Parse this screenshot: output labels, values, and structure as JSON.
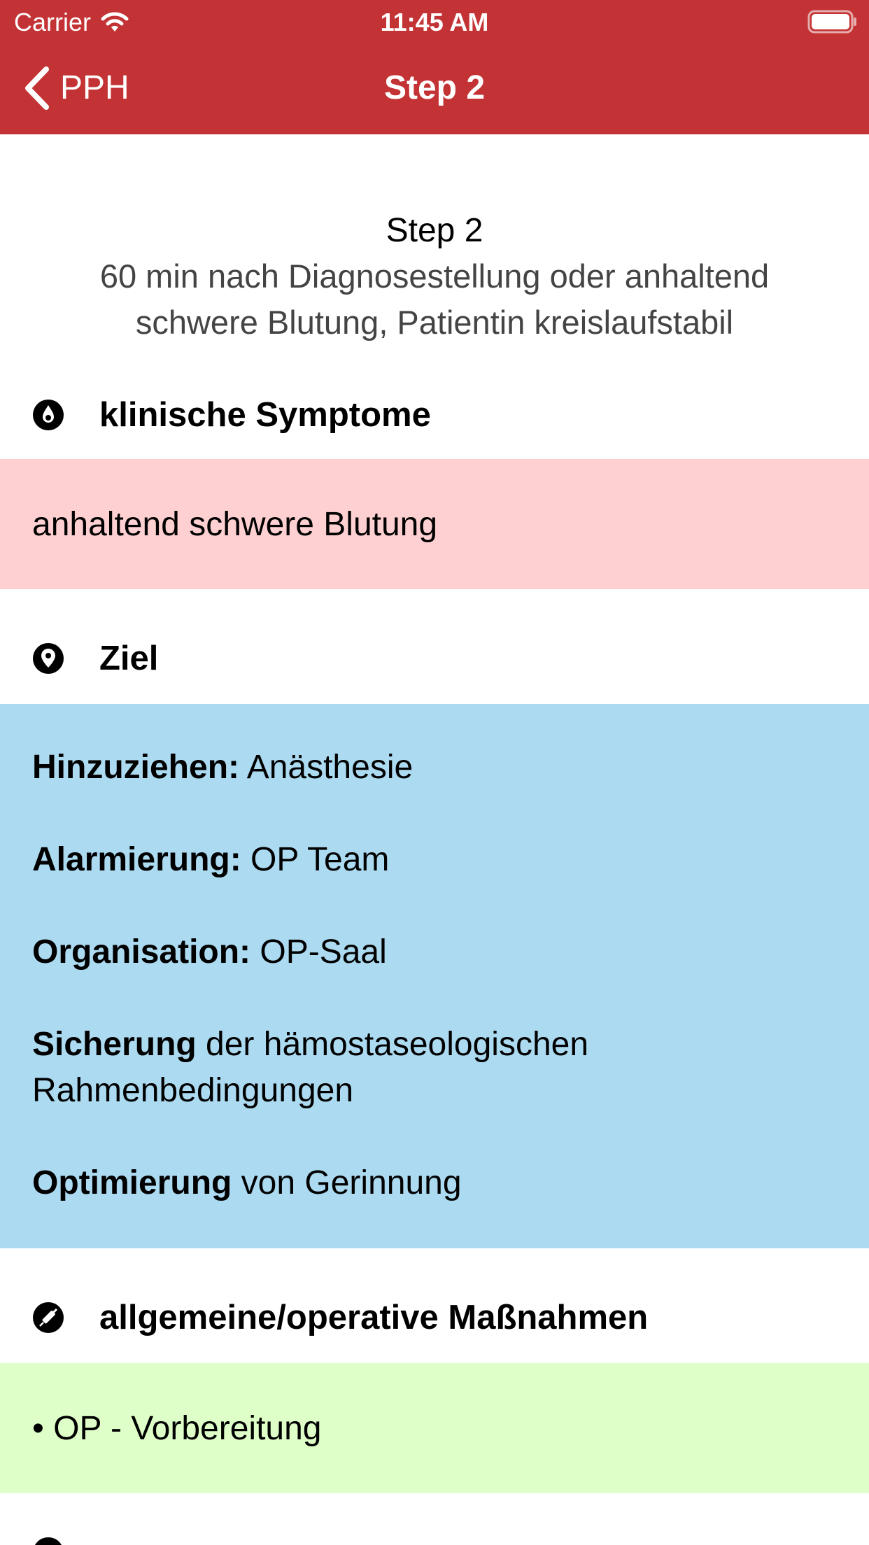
{
  "status_bar": {
    "carrier": "Carrier",
    "time": "11:45 AM"
  },
  "nav": {
    "back_label": "PPH",
    "title": "Step 2",
    "bar_color": "#c33234"
  },
  "header": {
    "step": "Step 2",
    "subtitle": "60 min nach Diagnosestellung oder anhaltend schwere Blutung, Patientin kreislaufstabil"
  },
  "sections": {
    "symptoms": {
      "icon": "blood-drop-icon",
      "title": "klinische Symptome",
      "text": "anhaltend schwere Blutung",
      "color": "#ffd0d1"
    },
    "goal": {
      "icon": "location-pin-icon",
      "title": "Ziel",
      "color": "#acdaf1",
      "lines": [
        {
          "key": "Hinzuziehen:",
          "value": " Anästhesie"
        },
        {
          "key": "Alarmierung:",
          "value": " OP Team"
        },
        {
          "key": "Organisation:",
          "value": " OP-Saal"
        },
        {
          "key": "Sicherung",
          "value": " der hämostaseologischen Rahmenbedingungen"
        },
        {
          "key": "Optimierung",
          "value": " von Gerinnung"
        }
      ]
    },
    "measures": {
      "icon": "syringe-icon",
      "title": "allgemeine/operative Maßnahmen",
      "text": "• OP - Vorbereitung",
      "color": "#deffc8"
    }
  }
}
